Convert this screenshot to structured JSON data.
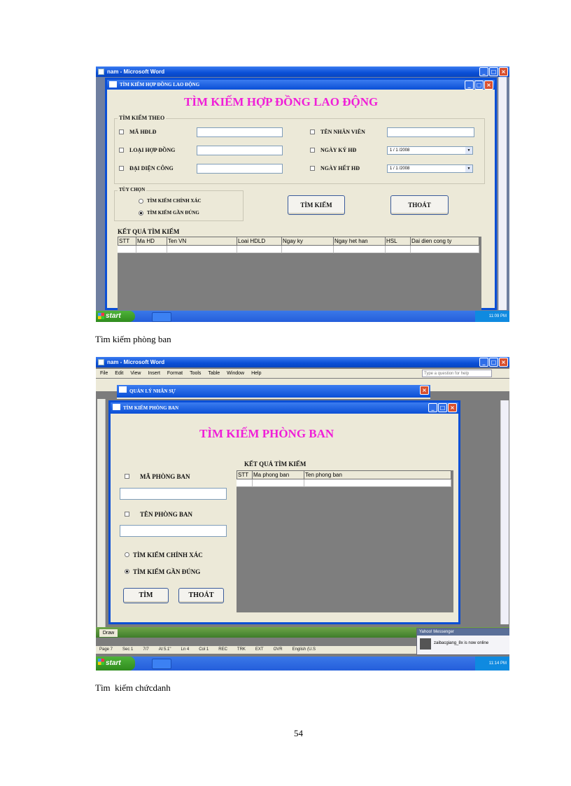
{
  "screenshot1": {
    "word_title": "nam - Microsoft Word",
    "dialog_title": "TÌM KIẾM HỢP ĐỒNG LAO ĐỘNG",
    "heading": "TÌM KIẾM HỢP ĐỒNG LAO ĐỘNG",
    "group_label": "TÌM KIẾM THEO",
    "fields": {
      "ma_hdld": "MÃ HĐLĐ",
      "loai_hop_dong": "LOẠI HỢP ĐỒNG",
      "dai_dien_cong": "ĐẠI DIỆN CÔNG",
      "ten_nhan_vien": "TÊN NHÂN VIÊN",
      "ngay_ky_hd": "NGÀY KÝ HĐ",
      "ngay_het_hd": "NGÀY HẾT HĐ"
    },
    "ngay_ky_value": "1 / 1 /2008",
    "ngay_het_value": "1 / 1 /2008",
    "options_label": "TÙY CHỌN",
    "option_exact": "TÌM KIẾM CHÍNH XÁC",
    "option_approx": "TÌM KIẾM GẦN ĐÚNG",
    "search_button": "TÌM KIẾM",
    "exit_button": "THOÁT",
    "results_label": "KẾT QUẢ TÌM KIẾM",
    "columns": [
      "STT",
      "Ma HD",
      "Ten VN",
      "Loai HDLD",
      "Ngay ky",
      "Ngay het han",
      "HSL",
      "Dai dien cong ty"
    ],
    "start_label": "start",
    "clock": "11:09 PM"
  },
  "caption1": "Tìm kiếm phòng ban",
  "screenshot2": {
    "word_title": "nam - Microsoft Word",
    "menu": [
      "File",
      "Edit",
      "View",
      "Insert",
      "Format",
      "Tools",
      "Table",
      "Window",
      "Help"
    ],
    "help_placeholder": "Type a question for help",
    "outer_title": "QUẢN LÝ NHÂN SỰ",
    "dialog_title": "TÌM KIẾM PHÒNG BAN",
    "heading": "TÌM KIẾM PHÒNG BAN",
    "ma_phong_ban": "MÃ PHÒNG BAN",
    "ten_phong_ban": "TÊN PHÒNG BAN",
    "option_exact": "TÌM KIẾM CHÍNH XÁC",
    "option_approx": "TÌM KIẾM GẦN ĐÚNG",
    "search_button": "TÌM",
    "exit_button": "THOÁT",
    "results_label": "KẾT QUẢ TÌM KIẾM",
    "columns": [
      "STT",
      "Ma phong ban",
      "Ten phong ban"
    ],
    "draw_label": "Draw",
    "status": [
      "Page 7",
      "Sec 1",
      "7/7",
      "At 5.1\"",
      "Ln 4",
      "Col 1",
      "REC",
      "TRK",
      "EXT",
      "OVR",
      "English (U.S"
    ],
    "messenger_title": "Yahoo! Messenger",
    "messenger_text": "zaibacgiang_8x is now online",
    "start_label": "start",
    "clock": "11:14 PM"
  },
  "caption2": "Tìm  kiếm chứcdanh",
  "page_number": "54"
}
